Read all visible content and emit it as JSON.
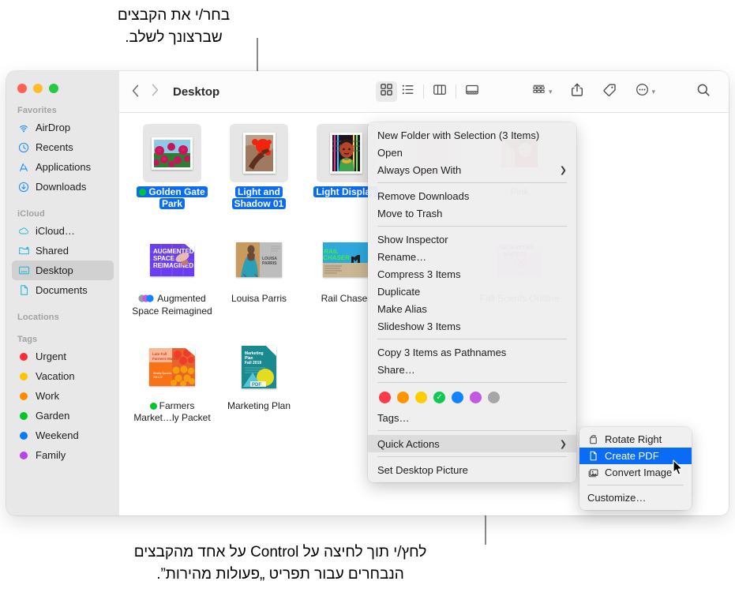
{
  "callouts": {
    "top": {
      "text": "בחר/י את הקבצים\nשברצונך לשלב.",
      "line_name": "top-callout-line"
    },
    "bottom": {
      "text": "לחץ/י תוך לחיצה על Control על אחד מהקבצים\nהנבחרים עבור תפריט „פעולות מהירות”.",
      "line_name": "bottom-callout-line"
    }
  },
  "window": {
    "title": "Desktop",
    "traffic_lights": [
      "close",
      "minimize",
      "zoom"
    ]
  },
  "toolbar": {
    "back_label": "‹",
    "forward_label": "›",
    "view_icon_grid": "grid-view-icon",
    "view_icon_list": "list-view-icon",
    "view_icon_column": "column-view-icon",
    "view_icon_gallery": "gallery-view-icon",
    "group_icon": "group-by-icon",
    "share_icon": "share-icon",
    "tag_icon": "tag-icon",
    "more_icon": "more-actions-icon",
    "search_icon": "search-icon"
  },
  "sidebar": {
    "groups": [
      {
        "label": "Favorites",
        "items": [
          {
            "label": "AirDrop",
            "icon": "airdrop-icon",
            "selected": false
          },
          {
            "label": "Recents",
            "icon": "clock-icon",
            "selected": false
          },
          {
            "label": "Applications",
            "icon": "applications-icon",
            "selected": false
          },
          {
            "label": "Downloads",
            "icon": "downloads-icon",
            "selected": false
          }
        ]
      },
      {
        "label": "iCloud",
        "items": [
          {
            "label": "iCloud…",
            "icon": "cloud-icon",
            "selected": false
          },
          {
            "label": "Shared",
            "icon": "shared-folder-icon",
            "selected": false
          },
          {
            "label": "Desktop",
            "icon": "desktop-icon",
            "selected": true
          },
          {
            "label": "Documents",
            "icon": "document-icon",
            "selected": false
          }
        ]
      },
      {
        "label": "Locations",
        "items": []
      },
      {
        "label": "Tags",
        "items": [
          {
            "label": "Urgent",
            "icon": "tag-dot",
            "color": "#fb2c36"
          },
          {
            "label": "Vacation",
            "icon": "tag-dot",
            "color": "#ffc400"
          },
          {
            "label": "Work",
            "icon": "tag-dot",
            "color": "#ff8c00"
          },
          {
            "label": "Garden",
            "icon": "tag-dot",
            "color": "#00c62c"
          },
          {
            "label": "Weekend",
            "icon": "tag-dot",
            "color": "#0a7bf5"
          },
          {
            "label": "Family",
            "icon": "tag-dot",
            "color": "#b545e8"
          }
        ]
      }
    ]
  },
  "files": {
    "rows": [
      [
        {
          "name": "Golden Gate Park",
          "selected": true,
          "tag_color": "#00c62c",
          "kind": "photo",
          "thumb": "flowers"
        },
        {
          "name": "Light and Shadow 01",
          "selected": true,
          "tag_color": null,
          "kind": "photo",
          "thumb": "redhand"
        },
        {
          "name": "Light Display",
          "selected": true,
          "tag_color": null,
          "kind": "photo",
          "thumb": "neon"
        },
        {
          "name": "",
          "selected": false,
          "kind": "photo",
          "thumb": "hidden"
        },
        {
          "name": "Pink",
          "selected": false,
          "tag_color": null,
          "kind": "photo",
          "thumb": "pink"
        }
      ],
      [
        {
          "name": "Augmented Space Reimagined",
          "selected": false,
          "tag_color": "multi",
          "kind": "doc",
          "thumb": "augmented"
        },
        {
          "name": "Louisa Parris",
          "selected": false,
          "tag_color": null,
          "kind": "doc",
          "thumb": "louisa"
        },
        {
          "name": "Rail Chaser",
          "selected": false,
          "tag_color": null,
          "kind": "doc",
          "thumb": "rail"
        },
        {
          "name": "",
          "selected": false,
          "kind": "doc",
          "thumb": "hidden"
        },
        {
          "name": "Fall Scents Outline",
          "selected": false,
          "tag_color": null,
          "kind": "doc",
          "thumb": "scents"
        }
      ],
      [
        {
          "name": "Farmers Market…ly Packet",
          "selected": false,
          "tag_color": "#00c62c",
          "kind": "doc",
          "thumb": "farmers"
        },
        {
          "name": "Marketing Plan",
          "selected": false,
          "tag_color": null,
          "kind": "doc",
          "thumb": "marketing"
        }
      ]
    ]
  },
  "context_menu": {
    "sections": [
      {
        "items": [
          {
            "label": "New Folder with Selection (3 Items)",
            "submenu": false,
            "highlighted": false
          },
          {
            "label": "Open",
            "submenu": false,
            "highlighted": false
          },
          {
            "label": "Always Open With",
            "submenu": true,
            "highlighted": false
          }
        ]
      },
      {
        "items": [
          {
            "label": "Remove Downloads",
            "submenu": false,
            "highlighted": false
          },
          {
            "label": "Move to Trash",
            "submenu": false,
            "highlighted": false
          }
        ]
      },
      {
        "items": [
          {
            "label": "Show Inspector",
            "submenu": false,
            "highlighted": false
          },
          {
            "label": "Rename…",
            "submenu": false,
            "highlighted": false
          },
          {
            "label": "Compress 3 Items",
            "submenu": false,
            "highlighted": false
          },
          {
            "label": "Duplicate",
            "submenu": false,
            "highlighted": false
          },
          {
            "label": "Make Alias",
            "submenu": false,
            "highlighted": false
          },
          {
            "label": "Slideshow 3 Items",
            "submenu": false,
            "highlighted": false
          }
        ]
      },
      {
        "items": [
          {
            "label": "Copy 3 Items as Pathnames",
            "submenu": false,
            "highlighted": false
          },
          {
            "label": "Share…",
            "submenu": false,
            "highlighted": false
          }
        ]
      }
    ],
    "tag_colors": [
      {
        "name": "red",
        "hex": "#fb3b4a",
        "checked": false
      },
      {
        "name": "orange",
        "hex": "#ff9500",
        "checked": false
      },
      {
        "name": "yellow",
        "hex": "#ffcc00",
        "checked": false
      },
      {
        "name": "green",
        "hex": "#0ec952",
        "checked": true
      },
      {
        "name": "blue",
        "hex": "#1284ff",
        "checked": false
      },
      {
        "name": "purple",
        "hex": "#c359e3",
        "checked": false
      },
      {
        "name": "gray",
        "hex": "#a6a6a6",
        "checked": false
      }
    ],
    "tags_label": "Tags…",
    "quick_actions_label": "Quick Actions",
    "set_desktop_label": "Set Desktop Picture"
  },
  "submenu": {
    "items": [
      {
        "label": "Rotate Right",
        "icon": "rotate-right-icon",
        "highlighted": false
      },
      {
        "label": "Create PDF",
        "icon": "pdf-icon",
        "highlighted": true
      },
      {
        "label": "Convert Image",
        "icon": "convert-image-icon",
        "highlighted": false
      }
    ],
    "customize_label": "Customize…"
  },
  "colors": {
    "accent": "#0a6cf5",
    "sidebar_bg": "#e9e8e8",
    "menu_bg": "#eeeeee"
  }
}
